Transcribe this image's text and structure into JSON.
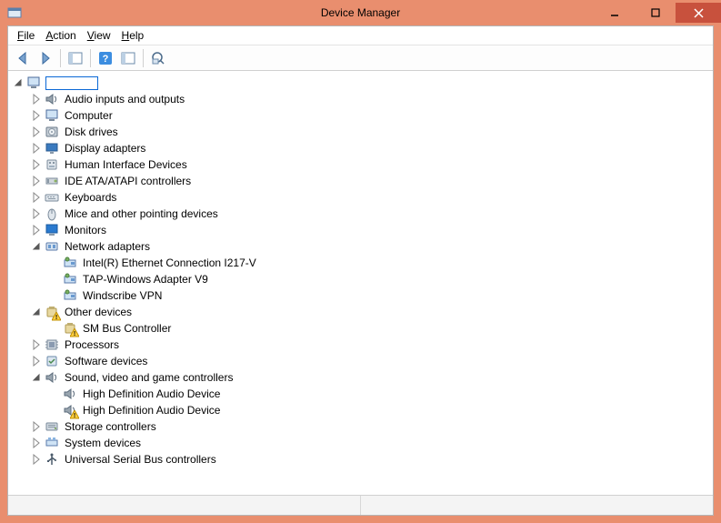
{
  "window": {
    "title": "Device Manager"
  },
  "menu": {
    "file": "File",
    "action": "Action",
    "view": "View",
    "help": "Help"
  },
  "tree": {
    "root": {
      "label": ""
    },
    "nodes": [
      {
        "id": "audio",
        "label": "Audio inputs and outputs",
        "icon": "speaker",
        "state": "collapsed",
        "depth": 1
      },
      {
        "id": "computer",
        "label": "Computer",
        "icon": "computer",
        "state": "collapsed",
        "depth": 1
      },
      {
        "id": "disk",
        "label": "Disk drives",
        "icon": "disk",
        "state": "collapsed",
        "depth": 1
      },
      {
        "id": "display",
        "label": "Display adapters",
        "icon": "display",
        "state": "collapsed",
        "depth": 1
      },
      {
        "id": "hid",
        "label": "Human Interface Devices",
        "icon": "hid",
        "state": "collapsed",
        "depth": 1
      },
      {
        "id": "ide",
        "label": "IDE ATA/ATAPI controllers",
        "icon": "ide",
        "state": "collapsed",
        "depth": 1
      },
      {
        "id": "keyboards",
        "label": "Keyboards",
        "icon": "keyboard",
        "state": "collapsed",
        "depth": 1
      },
      {
        "id": "mice",
        "label": "Mice and other pointing devices",
        "icon": "mouse",
        "state": "collapsed",
        "depth": 1
      },
      {
        "id": "monitors",
        "label": "Monitors",
        "icon": "monitor",
        "state": "collapsed",
        "depth": 1
      },
      {
        "id": "network",
        "label": "Network adapters",
        "icon": "network",
        "state": "expanded",
        "depth": 1
      },
      {
        "id": "net1",
        "label": "Intel(R) Ethernet Connection I217-V",
        "icon": "netcard",
        "state": "leaf",
        "depth": 2
      },
      {
        "id": "net2",
        "label": "TAP-Windows Adapter V9",
        "icon": "netcard",
        "state": "leaf",
        "depth": 2
      },
      {
        "id": "net3",
        "label": "Windscribe VPN",
        "icon": "netcard",
        "state": "leaf",
        "depth": 2
      },
      {
        "id": "other",
        "label": "Other devices",
        "icon": "other",
        "state": "expanded",
        "depth": 1,
        "warn": true
      },
      {
        "id": "smbus",
        "label": "SM Bus Controller",
        "icon": "other",
        "state": "leaf",
        "depth": 2,
        "warn": true
      },
      {
        "id": "processors",
        "label": "Processors",
        "icon": "cpu",
        "state": "collapsed",
        "depth": 1
      },
      {
        "id": "software",
        "label": "Software devices",
        "icon": "software",
        "state": "collapsed",
        "depth": 1
      },
      {
        "id": "sound",
        "label": "Sound, video and game controllers",
        "icon": "speaker",
        "state": "expanded",
        "depth": 1
      },
      {
        "id": "hda1",
        "label": "High Definition Audio Device",
        "icon": "speaker",
        "state": "leaf",
        "depth": 2
      },
      {
        "id": "hda2",
        "label": "High Definition Audio Device",
        "icon": "speaker",
        "state": "leaf",
        "depth": 2,
        "warn": true
      },
      {
        "id": "storage",
        "label": "Storage controllers",
        "icon": "storage",
        "state": "collapsed",
        "depth": 1
      },
      {
        "id": "system",
        "label": "System devices",
        "icon": "system",
        "state": "collapsed",
        "depth": 1
      },
      {
        "id": "usb",
        "label": "Universal Serial Bus controllers",
        "icon": "usb",
        "state": "collapsed",
        "depth": 1
      }
    ]
  }
}
